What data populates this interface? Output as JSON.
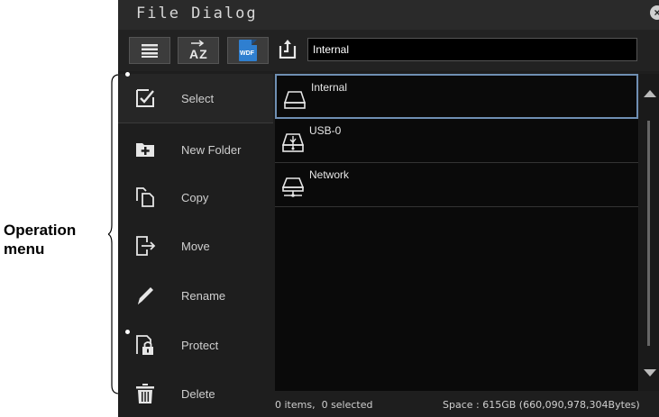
{
  "annotation": {
    "operation_menu_label": "Operation menu"
  },
  "dialog": {
    "title": "File Dialog",
    "close_icon": "close-icon"
  },
  "toolbar": {
    "list_view_icon": "list-icon",
    "sort_label": "AZ",
    "wdf_label": "WDF",
    "path_up_icon": "folder-up-icon",
    "path_value": "Internal"
  },
  "menu": {
    "items": [
      {
        "label": "Select",
        "icon": "select-check-icon"
      },
      {
        "label": "New Folder",
        "icon": "new-folder-icon"
      },
      {
        "label": "Copy",
        "icon": "copy-icon"
      },
      {
        "label": "Move",
        "icon": "move-icon"
      },
      {
        "label": "Rename",
        "icon": "pencil-icon"
      },
      {
        "label": "Protect",
        "icon": "lock-icon"
      },
      {
        "label": "Delete",
        "icon": "trash-icon"
      }
    ]
  },
  "files": {
    "rows": [
      {
        "label": "Internal",
        "icon": "drive-icon",
        "selected": true
      },
      {
        "label": "USB-0",
        "icon": "usb-icon",
        "selected": false
      },
      {
        "label": "Network",
        "icon": "network-icon",
        "selected": false
      }
    ]
  },
  "status": {
    "items": "0 items,  0 selected",
    "space": "Space : 615GB (660,090,978,304Bytes)"
  },
  "colors": {
    "dialog_bg": "#1e1e1e",
    "list_bg": "#0a0a0a",
    "selected_border": "#6f8fb3",
    "wdf_blue": "#2f7fd0"
  }
}
